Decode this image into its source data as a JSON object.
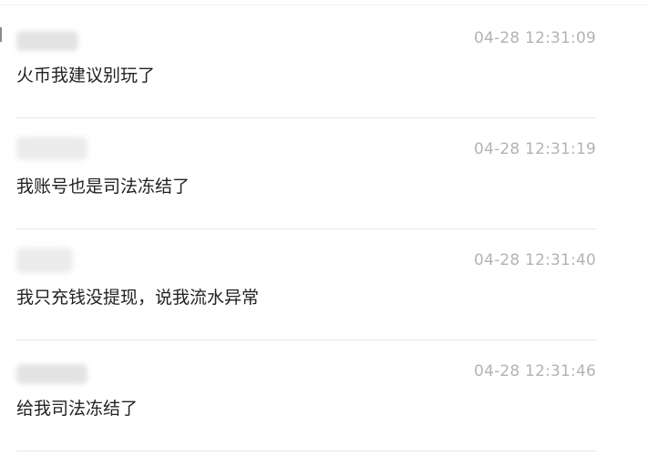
{
  "comments": [
    {
      "username": "",
      "timestamp": "04-28 12:31:09",
      "text": "火币我建议别玩了"
    },
    {
      "username": "",
      "timestamp": "04-28 12:31:19",
      "text": "我账号也是司法冻结了"
    },
    {
      "username": "",
      "timestamp": "04-28 12:31:40",
      "text": "我只充钱没提现，说我流水异常"
    },
    {
      "username": "",
      "timestamp": "04-28 12:31:46",
      "text": "给我司法冻结了"
    }
  ]
}
